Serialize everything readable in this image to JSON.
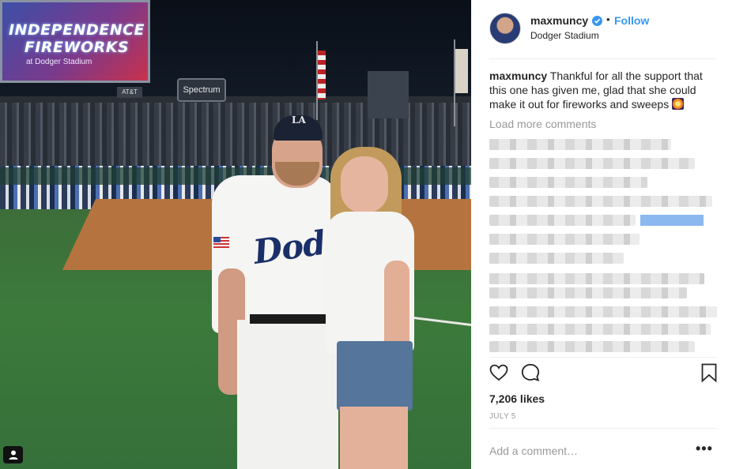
{
  "photo": {
    "scoreboard_title": "INDEPENDENCE FIREWORKS",
    "scoreboard_sub": "at Dodger Stadium",
    "sign_main": "Spectrum",
    "sign_small": "AT&T",
    "cap_logo": "LA",
    "jersey_text": "Dodgers"
  },
  "header": {
    "username": "maxmuncy",
    "follow_label": "Follow",
    "separator": "•",
    "location": "Dodger Stadium"
  },
  "caption": {
    "username": "maxmuncy",
    "text": "Thankful for all the support that this one has given me, glad that she could make it out for fireworks and sweeps"
  },
  "comments": {
    "load_more_label": "Load more comments"
  },
  "actions": {
    "like_icon": "heart-icon",
    "comment_icon": "comment-icon",
    "save_icon": "bookmark-icon"
  },
  "stats": {
    "likes": "7,206 likes",
    "date": "JULY 5"
  },
  "comment_box": {
    "placeholder": "Add a comment…",
    "more_label": "•••"
  },
  "colors": {
    "accent": "#3897f0",
    "muted": "#999999",
    "text": "#262626"
  }
}
